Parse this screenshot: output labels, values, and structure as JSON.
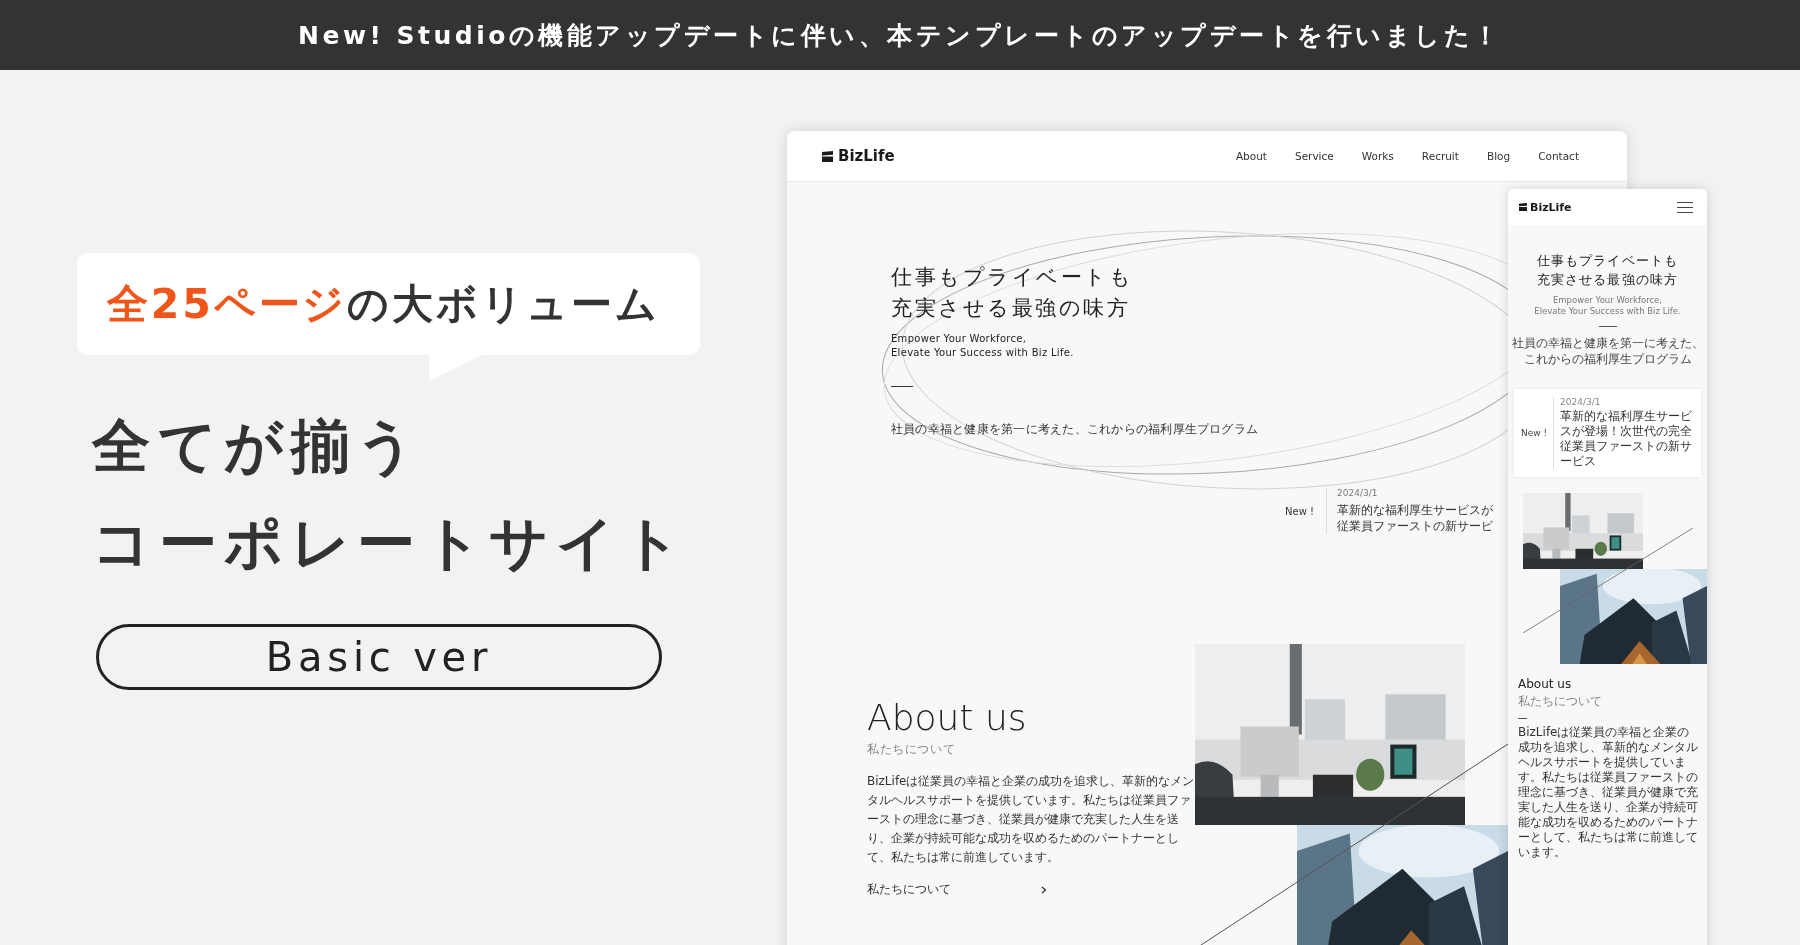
{
  "announcement_bar": {
    "text": "New! Studioの機能アップデートに伴い、本テンプレートのアップデートを行いました！"
  },
  "bubble": {
    "highlight": "全25ページ",
    "rest": "の大ボリューム"
  },
  "title_lines": [
    "全てが揃う",
    "コーポレートサイト"
  ],
  "version_badge": "Basic ver",
  "desktop_mockup": {
    "logo": "BizLife",
    "nav": [
      "About",
      "Service",
      "Works",
      "Recruit",
      "Blog",
      "Contact"
    ],
    "hero": {
      "title_lines": [
        "仕事もプライベートも",
        "充実させる最強の味方"
      ],
      "subtitle_lines": [
        "Empower Your Workforce,",
        "Elevate Your Success with Biz Life."
      ],
      "lead": "社員の幸福と健康を第一に考えた、これからの福利厚生プログラム"
    },
    "news": {
      "label": "New !",
      "date": "2024/3/1",
      "lines": [
        "革新的な福利厚生サービスが",
        "従業員ファーストの新サービ"
      ]
    },
    "about": {
      "heading": "About us",
      "subheading": "私たちについて",
      "paragraph_lines": [
        "BizLifeは従業員の幸福と企業の成功を追求し、革新的なメン",
        "タルヘルスサポートを提供しています。私たちは従業員ファ",
        "ーストの理念に基づき、従業員が健康で充実した人生を送",
        "り、企業が持続可能な成功を収めるためのパートナーとし",
        "て、私たちは常に前進しています。"
      ],
      "link": "私たちについて"
    }
  },
  "mobile_mockup": {
    "logo": "BizLife",
    "hero": {
      "title_lines": [
        "仕事もプライベートも",
        "充実させる最強の味方"
      ],
      "subtitle_lines": [
        "Empower Your Workforce,",
        "Elevate Your Success with Biz Life."
      ],
      "lead_lines": [
        "社員の幸福と健康を第一に考えた、",
        "これからの福利厚生プログラム"
      ]
    },
    "news": {
      "label": "New !",
      "date": "2024/3/1",
      "title": "革新的な福利厚生サービスが登場！次世代の完全従業員ファーストの新サービス"
    },
    "about": {
      "heading": "About us",
      "subheading": "私たちについて",
      "paragraph": "BizLifeは従業員の幸福と企業の成功を追求し、革新的なメンタルヘルスサポートを提供しています。私たちは従業員ファーストの理念に基づき、従業員が健康で充実した人生を送り、企業が持続可能な成功を収めるためのパートナーとして、私たちは常に前進しています。"
    }
  }
}
